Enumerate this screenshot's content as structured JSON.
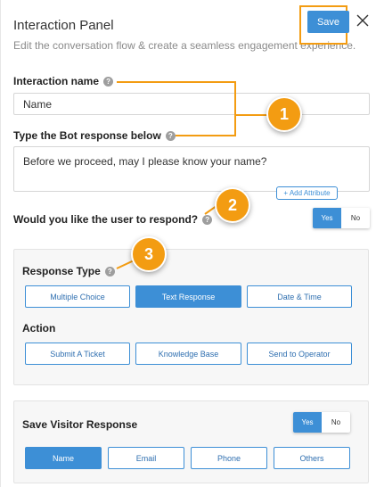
{
  "header": {
    "title": "Interaction Panel",
    "subtitle": "Edit the conversation flow & create a seamless engagement experience.",
    "save_label": "Save"
  },
  "interaction_name": {
    "label": "Interaction name",
    "value": "Name"
  },
  "bot_response": {
    "label": "Type the Bot response below",
    "value": "Before we proceed, may I please know your name?",
    "add_attribute_label": "+ Add Attribute"
  },
  "user_respond": {
    "label": "Would you like the user to respond?",
    "yes_label": "Yes",
    "no_label": "No",
    "selected": "Yes"
  },
  "response_type": {
    "label": "Response Type",
    "options": [
      "Multiple Choice",
      "Text Response",
      "Date & Time"
    ],
    "selected": "Text Response"
  },
  "action": {
    "label": "Action",
    "options": [
      "Submit A Ticket",
      "Knowledge Base",
      "Send to Operator"
    ]
  },
  "save_visitor": {
    "label": "Save Visitor Response",
    "yes_label": "Yes",
    "no_label": "No",
    "selected": "Yes",
    "options": [
      "Name",
      "Email",
      "Phone",
      "Others"
    ],
    "selected_option": "Name"
  },
  "callouts": [
    "1",
    "2",
    "3"
  ],
  "colors": {
    "accent": "#3d8fd6",
    "callout": "#f39c12"
  }
}
